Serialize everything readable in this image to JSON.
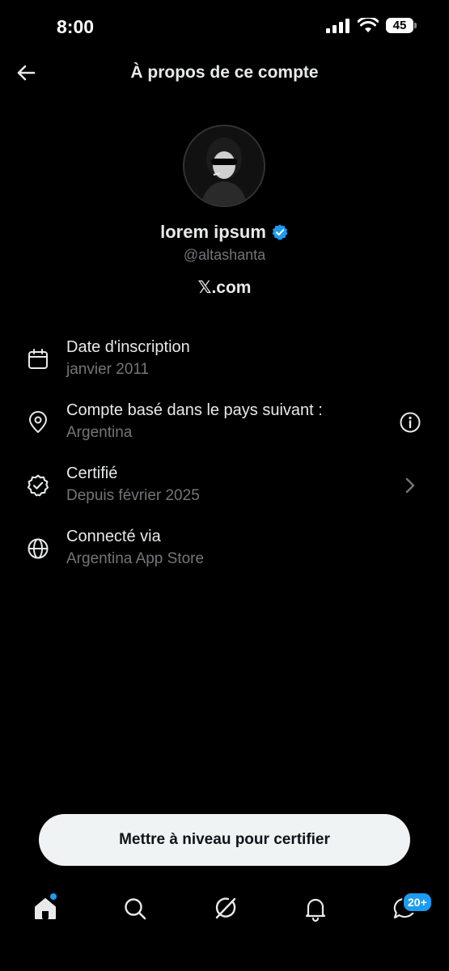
{
  "status_bar": {
    "time": "8:00",
    "battery": "45"
  },
  "header": {
    "title": "À propos de ce compte",
    "back_icon": "arrow-left-icon"
  },
  "profile": {
    "name": "lorem ipsum",
    "handle": "@altashanta",
    "site": "𝕏.com",
    "verified_color": "#1d9bf0"
  },
  "rows": [
    {
      "icon": "calendar-icon",
      "label": "Date d'inscription",
      "value": "janvier 2011"
    },
    {
      "icon": "location-pin-icon",
      "label": "Compte basé dans le pays suivant :",
      "value": "Argentina",
      "trailing": "info-icon"
    },
    {
      "icon": "verified-badge-icon",
      "label": "Certifié",
      "value": "Depuis février 2025",
      "trailing": "chevron-right-icon"
    },
    {
      "icon": "globe-icon",
      "label": "Connecté via",
      "value": "Argentina App Store"
    }
  ],
  "upgrade_button": {
    "label": "Mettre à niveau pour certifier"
  },
  "bottom_nav": {
    "tabs": [
      "home-icon",
      "search-icon",
      "grok-icon",
      "bell-icon",
      "messages-icon"
    ],
    "messages_badge": "20+",
    "accent": "#1d9bf0"
  }
}
